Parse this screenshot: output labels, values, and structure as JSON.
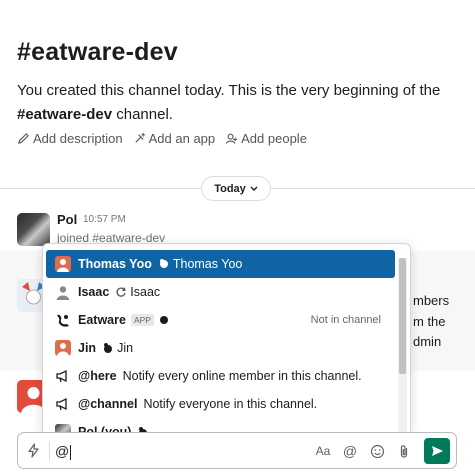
{
  "channel": {
    "title": "#eatware-dev",
    "intro_prefix": "You created this channel today. This is the very beginning of the ",
    "intro_channel": "#eatware-dev",
    "intro_suffix": " channel."
  },
  "actions": [
    {
      "label": "Add description",
      "icon": "pencil-icon"
    },
    {
      "label": "Add an app",
      "icon": "add-app-icon"
    },
    {
      "label": "Add people",
      "icon": "add-person-icon"
    }
  ],
  "date_divider": {
    "label": "Today",
    "icon": "chevron-down-icon"
  },
  "message": {
    "author": "Pol",
    "time": "10:57 PM",
    "text": "joined #eatware-dev"
  },
  "background_fragments": [
    "mbers",
    "m the",
    "dmin"
  ],
  "mention_popup": {
    "items": [
      {
        "username": "Thomas Yoo",
        "realname": "Thomas Yoo",
        "selected": true,
        "avatar_color": "#e06c4e"
      },
      {
        "username": "Isaac",
        "realname": "Isaac",
        "selected": false,
        "avatar_color": "#8a8a8a"
      },
      {
        "username": "Eatware",
        "badge": "APP",
        "note": "Not in channel",
        "selected": false
      },
      {
        "username": "Jin",
        "realname": "Jin",
        "selected": false,
        "avatar_color": "#e06c4e"
      },
      {
        "username": "@here",
        "description": "Notify every online member in this channel.",
        "selected": false
      },
      {
        "username": "@channel",
        "description": "Notify everyone in this channel.",
        "selected": false
      },
      {
        "username": "Pol (you)",
        "selected": false
      }
    ]
  },
  "composer": {
    "value": "@",
    "tools": [
      "Aa",
      "@",
      "emoji-icon",
      "attach-icon",
      "send-icon"
    ],
    "accent": "#007a5a"
  },
  "colors": {
    "selected": "#1164a3",
    "text": "#1d1c1d"
  }
}
